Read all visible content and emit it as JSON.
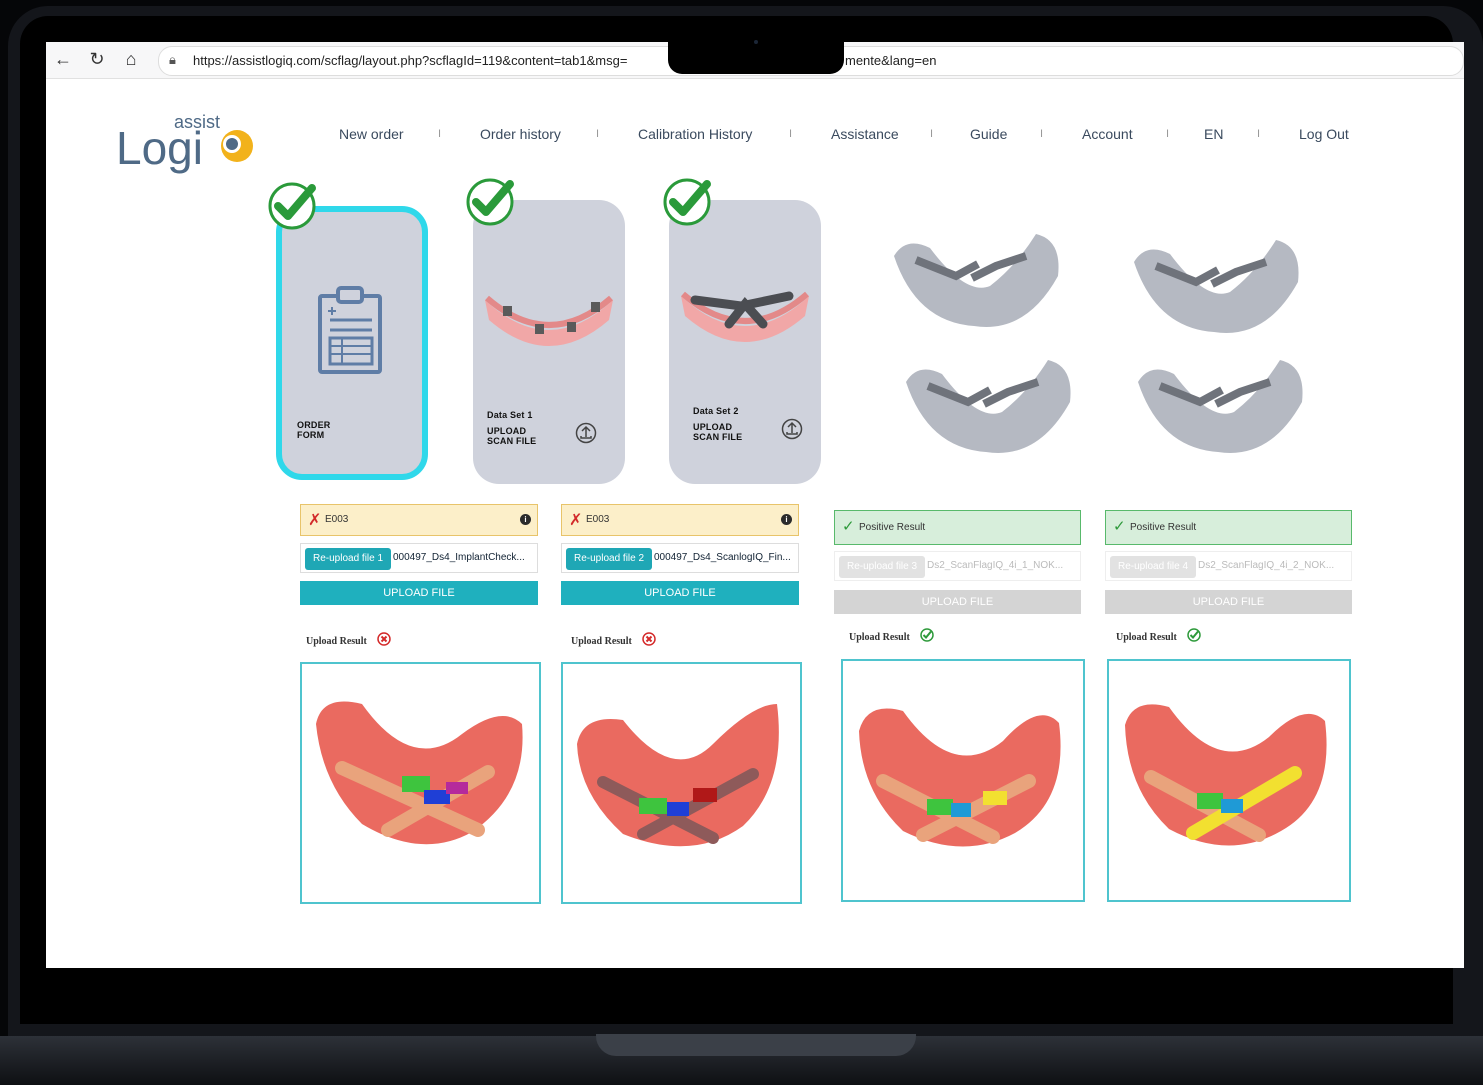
{
  "browser": {
    "url": "https://assistlogiq.com/scflag/layout.php?scflagId=119&content=tab1&msg=",
    "url_tail": "mente&lang=en"
  },
  "logo": {
    "small": "assist",
    "main": "Logi",
    "brand_colors": {
      "text": "#4f6a86",
      "accent": "#f2b21b"
    }
  },
  "nav": {
    "items": [
      "New order",
      "Order history",
      "Calibration History",
      "Assistance",
      "Guide",
      "Account",
      "EN",
      "Log Out"
    ],
    "separator": "I"
  },
  "cards": {
    "order_form": {
      "line1": "ORDER",
      "line2": "FORM"
    },
    "ds1": {
      "title": "Data Set 1",
      "line1": "UPLOAD",
      "line2": "SCAN FILE"
    },
    "ds2": {
      "title": "Data Set 2",
      "line1": "UPLOAD",
      "line2": "SCAN FILE"
    }
  },
  "slots": [
    {
      "status": "error",
      "status_text": "E003",
      "reupload_label": "Re-upload file 1",
      "filename": "000497_Ds4_ImplantCheck...",
      "upload_label": "UPLOAD FILE",
      "result_label": "Upload Result",
      "result": "fail"
    },
    {
      "status": "error",
      "status_text": "E003",
      "reupload_label": "Re-upload file 2",
      "filename": "000497_Ds4_ScanlogIQ_Fin...",
      "upload_label": "UPLOAD FILE",
      "result_label": "Upload Result",
      "result": "fail"
    },
    {
      "status": "ok",
      "status_text": "Positive Result",
      "reupload_label": "Re-upload file 3",
      "filename": "Ds2_ScanFlagIQ_4i_1_NOK...",
      "upload_label": "UPLOAD FILE",
      "result_label": "Upload Result",
      "result": "pass"
    },
    {
      "status": "ok",
      "status_text": "Positive Result",
      "reupload_label": "Re-upload file 4",
      "filename": "Ds2_ScanFlagIQ_4i_2_NOK...",
      "upload_label": "UPLOAD FILE",
      "result_label": "Upload Result",
      "result": "pass"
    }
  ],
  "colors": {
    "accent_teal": "#1fb0be",
    "card_bg": "#cfd2dc",
    "active_border": "#2fd8ea",
    "error_bg": "#fcefc9",
    "ok_bg": "#d7eedb",
    "model_red": "#ea6a60"
  }
}
